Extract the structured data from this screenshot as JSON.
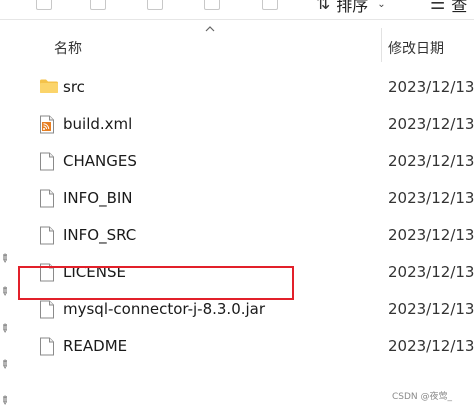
{
  "toolbar": {
    "sort_label": "排序",
    "view_label": "查"
  },
  "columns": {
    "name_header": "名称",
    "date_header": "修改日期"
  },
  "files": [
    {
      "name": "src",
      "date": "2023/12/13",
      "type": "folder-icon"
    },
    {
      "name": "build.xml",
      "date": "2023/12/13",
      "type": "xml-file-icon"
    },
    {
      "name": "CHANGES",
      "date": "2023/12/13",
      "type": "file-icon"
    },
    {
      "name": "INFO_BIN",
      "date": "2023/12/13",
      "type": "file-icon"
    },
    {
      "name": "INFO_SRC",
      "date": "2023/12/13",
      "type": "file-icon"
    },
    {
      "name": "LICENSE",
      "date": "2023/12/13",
      "type": "file-icon"
    },
    {
      "name": "mysql-connector-j-8.3.0.jar",
      "date": "2023/12/13",
      "type": "file-icon"
    },
    {
      "name": "README",
      "date": "2023/12/13",
      "type": "file-icon"
    }
  ],
  "highlight_color": "#e2202a",
  "watermark": "CSDN @夜莺_"
}
